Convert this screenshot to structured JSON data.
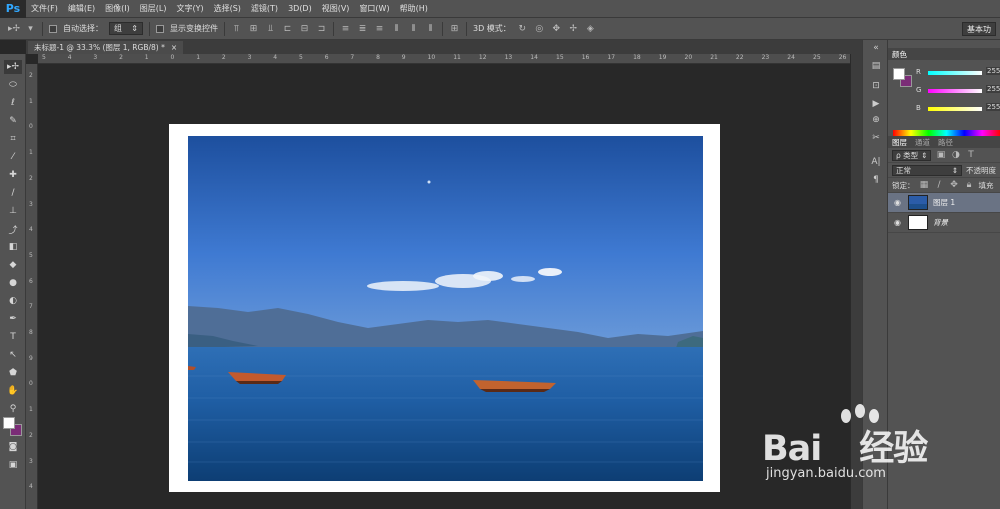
{
  "app": {
    "logo": "Ps"
  },
  "menu": [
    "文件(F)",
    "编辑(E)",
    "图像(I)",
    "图层(L)",
    "文字(Y)",
    "选择(S)",
    "滤镜(T)",
    "3D(D)",
    "视图(V)",
    "窗口(W)",
    "帮助(H)"
  ],
  "options": {
    "auto_select_label": "自动选择：",
    "auto_select_value": "组",
    "show_transform_label": "显示变换控件",
    "mode_3d_label": "3D 模式：",
    "workspace": "基本功"
  },
  "document": {
    "tab_title": "未标题-1 @ 33.3% (图层 1, RGB/8) *",
    "close_glyph": "×"
  },
  "ruler_top": [
    "5",
    "4",
    "3",
    "2",
    "1",
    "0",
    "1",
    "2",
    "3",
    "4",
    "5",
    "6",
    "7",
    "8",
    "9",
    "10",
    "11",
    "12",
    "13",
    "14",
    "15",
    "16",
    "17",
    "18",
    "19",
    "20",
    "21",
    "22",
    "23",
    "24",
    "25",
    "26"
  ],
  "ruler_left": [
    "2",
    "1",
    "0",
    "1",
    "2",
    "3",
    "4",
    "5",
    "6",
    "7",
    "8",
    "9",
    "0",
    "1",
    "2",
    "3",
    "4"
  ],
  "color_panel": {
    "title": "颜色",
    "fg": "#ffffff",
    "bg": "#7b2d77",
    "r_label": "R",
    "r_value": "255",
    "g_label": "G",
    "g_value": "255",
    "b_label": "B",
    "b_value": "255"
  },
  "layers_panel": {
    "tabs": [
      "图层",
      "通道",
      "路径"
    ],
    "filter": "ρ 类型",
    "blend_mode": "正常",
    "opacity_label": "不透明度",
    "lock_label": "锁定：",
    "fill_label": "填充",
    "layers": [
      {
        "name": "图层 1",
        "selected": true
      },
      {
        "name": "背景",
        "selected": false
      }
    ]
  },
  "watermark": {
    "text": "Bai",
    "text2": "经验",
    "url": "jingyan.baidu.com"
  }
}
